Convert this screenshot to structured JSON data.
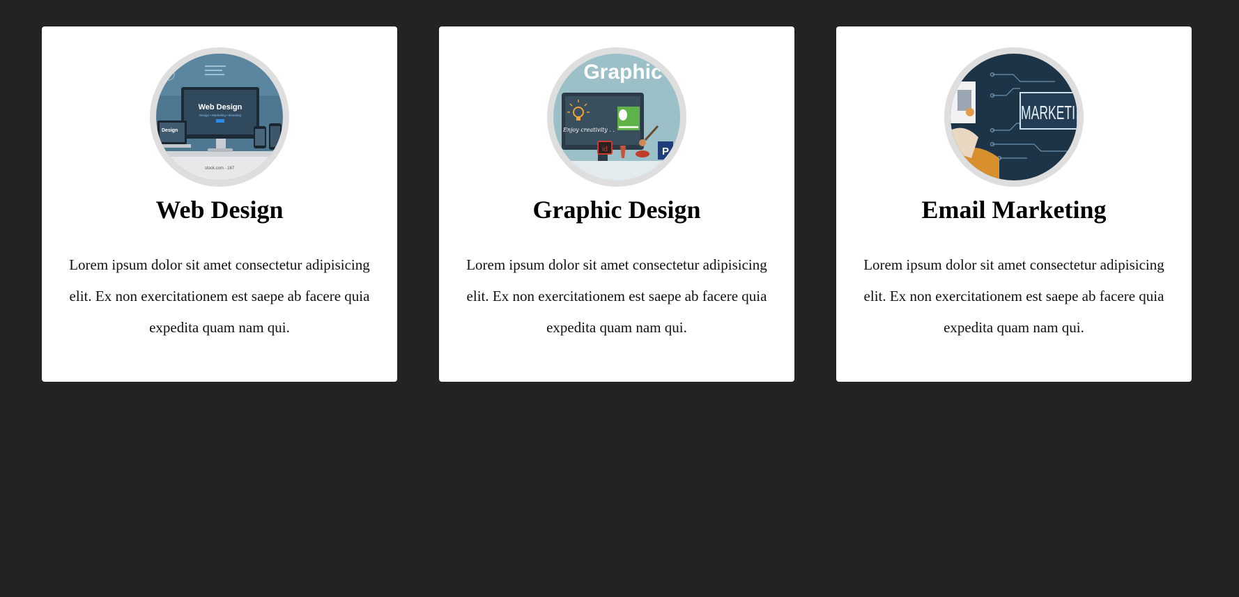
{
  "page": {
    "background_color": "#232323",
    "card_color": "#ffffff"
  },
  "cards": [
    {
      "title": "Web Design",
      "image_icon": "web-design-image",
      "image_text": "Web Design",
      "image_subtext": "Design • Marketing • Branding",
      "image_footer": "stock.com - 167",
      "body": "Lorem ipsum dolor sit amet consectetur adipisicing elit. Ex non exercitationem est saepe ab facere quia expedita quam nam qui."
    },
    {
      "title": "Graphic Design",
      "image_icon": "graphic-design-image",
      "image_text": "Graphic",
      "image_subtext": "Enjoy creativity . .",
      "body": "Lorem ipsum dolor sit amet consectetur adipisicing elit. Ex non exercitationem est saepe ab facere quia expedita quam nam qui."
    },
    {
      "title": "Email Marketing",
      "image_icon": "email-marketing-image",
      "image_text": "MARKETI",
      "body": "Lorem ipsum dolor sit amet consectetur adipisicing elit. Ex non exercitationem est saepe ab facere quia expedita quam nam qui."
    }
  ]
}
